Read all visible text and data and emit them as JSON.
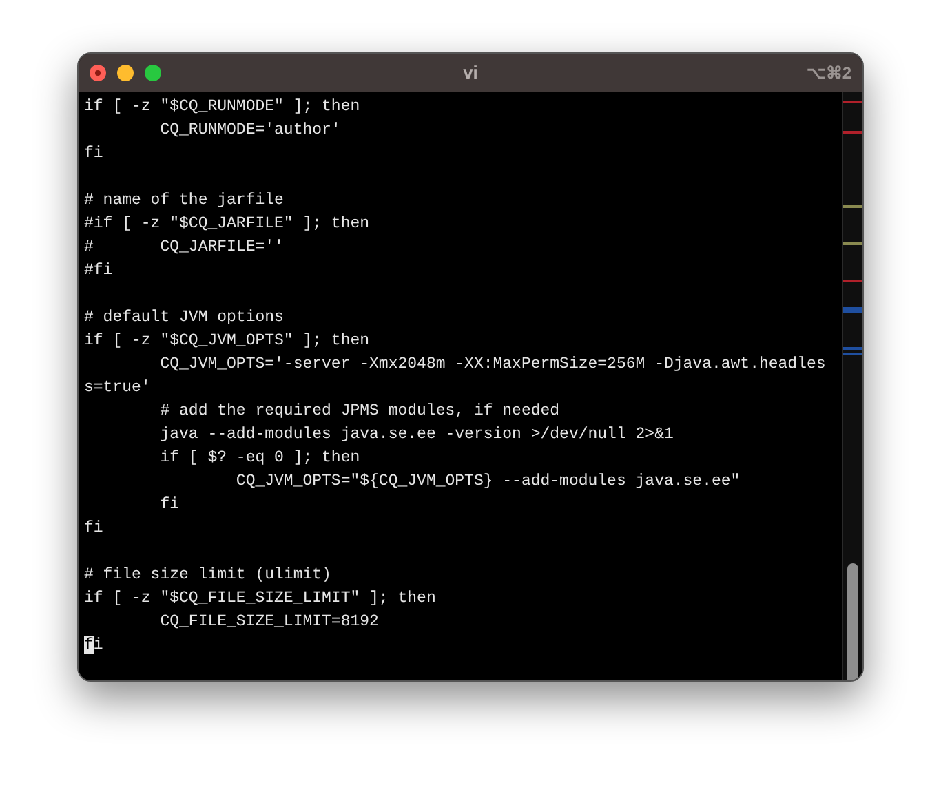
{
  "window": {
    "title": "vi",
    "shortcut": "⌥⌘2"
  },
  "lines": [
    {
      "kind": "code",
      "text": "if [ -z \"$CQ_RUNMODE\" ]; then"
    },
    {
      "kind": "code",
      "text": "        CQ_RUNMODE='author'"
    },
    {
      "kind": "code",
      "text": "fi"
    },
    {
      "kind": "blank"
    },
    {
      "kind": "code",
      "text": "# name of the jarfile"
    },
    {
      "kind": "code",
      "text": "#if [ -z \"$CQ_JARFILE\" ]; then"
    },
    {
      "kind": "code",
      "text": "#       CQ_JARFILE=''"
    },
    {
      "kind": "code",
      "text": "#fi"
    },
    {
      "kind": "blank"
    },
    {
      "kind": "code",
      "text": "# default JVM options"
    },
    {
      "kind": "code",
      "text": "if [ -z \"$CQ_JVM_OPTS\" ]; then"
    },
    {
      "kind": "code",
      "text": "        CQ_JVM_OPTS='-server -Xmx2048m -XX:MaxPermSize=256M -Djava.awt.headles"
    },
    {
      "kind": "code",
      "text": "s=true'"
    },
    {
      "kind": "code",
      "text": "        # add the required JPMS modules, if needed"
    },
    {
      "kind": "code",
      "text": "        java --add-modules java.se.ee -version >/dev/null 2>&1"
    },
    {
      "kind": "code",
      "text": "        if [ $? -eq 0 ]; then"
    },
    {
      "kind": "code",
      "text": "                CQ_JVM_OPTS=\"${CQ_JVM_OPTS} --add-modules java.se.ee\""
    },
    {
      "kind": "code",
      "text": "        fi"
    },
    {
      "kind": "code",
      "text": "fi"
    },
    {
      "kind": "blank"
    },
    {
      "kind": "code",
      "text": "# file size limit (ulimit)"
    },
    {
      "kind": "code",
      "text": "if [ -z \"$CQ_FILE_SIZE_LIMIT\" ]; then"
    },
    {
      "kind": "code",
      "text": "        CQ_FILE_SIZE_LIMIT=8192"
    },
    {
      "kind": "code",
      "text": "fi",
      "cursor": true
    }
  ]
}
